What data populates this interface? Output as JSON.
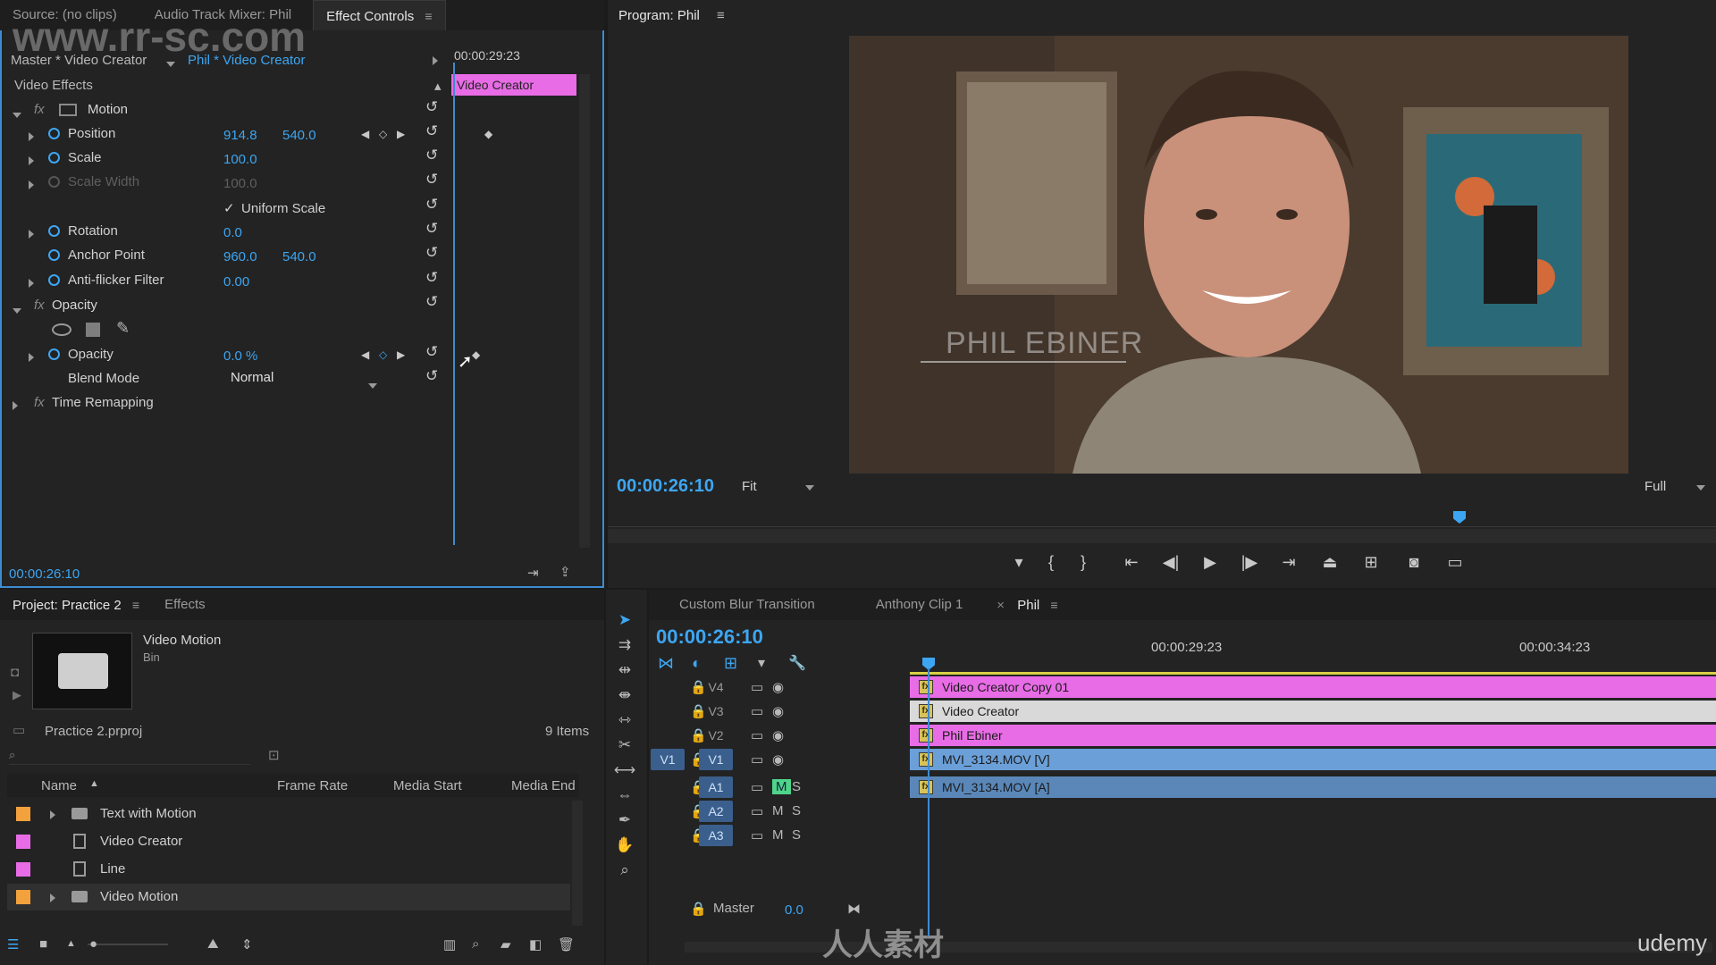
{
  "source_tabs": {
    "source": "Source: (no clips)",
    "mixer": "Audio Track Mixer: Phil",
    "effect_controls": "Effect Controls"
  },
  "effect_controls": {
    "master_label": "Master * Video Creator",
    "clip_label": "Phil * Video Creator",
    "timecode_head": "00:00:29:23",
    "clip_bar": "Video Creator",
    "section": "Video Effects",
    "motion": "Motion",
    "properties": [
      {
        "name": "Position",
        "v1": "914.8",
        "v2": "540.0"
      },
      {
        "name": "Scale",
        "v1": "100.0"
      },
      {
        "name": "Scale Width",
        "v1": "100.0"
      },
      {
        "name": "Rotation",
        "v1": "0.0"
      },
      {
        "name": "Anchor Point",
        "v1": "960.0",
        "v2": "540.0"
      },
      {
        "name": "Anti-flicker Filter",
        "v1": "0.00"
      }
    ],
    "uniform_scale": "Uniform Scale",
    "opacity_group": "Opacity",
    "opacity_prop": "Opacity",
    "opacity_value": "0.0 %",
    "blend_mode_label": "Blend Mode",
    "blend_mode_value": "Normal",
    "time_remapping": "Time Remapping",
    "footer_timecode": "00:00:26:10"
  },
  "program": {
    "title": "Program: Phil",
    "timecode": "00:00:26:10",
    "fit": "Fit",
    "quality": "Full",
    "lower_third": "PHIL EBINER"
  },
  "project": {
    "tab": "Project: Practice 2",
    "effects_tab": "Effects",
    "preview_name": "Video Motion",
    "preview_type": "Bin",
    "file": "Practice 2.prproj",
    "count": "9 Items",
    "columns": [
      "Name",
      "Frame Rate",
      "Media Start",
      "Media End"
    ],
    "items": [
      {
        "name": "Text with Motion",
        "color": "#f2a13c",
        "kind": "bin"
      },
      {
        "name": "Video Creator",
        "color": "#e86ce6",
        "kind": "seq"
      },
      {
        "name": "Line",
        "color": "#e86ce6",
        "kind": "seq"
      },
      {
        "name": "Video Motion",
        "color": "#f2a13c",
        "kind": "bin"
      }
    ]
  },
  "timeline": {
    "tabs": [
      "Custom Blur Transition",
      "Anthony Clip 1",
      "Phil"
    ],
    "timecode": "00:00:26:10",
    "ruler": [
      "00:00:29:23",
      "00:00:34:23"
    ],
    "tracks": [
      "V4",
      "V3",
      "V2",
      "V1",
      "A1",
      "A2",
      "A3"
    ],
    "source_patch": "V1",
    "master": "Master",
    "master_value": "0.0",
    "clips": [
      {
        "label": "Video Creator Copy 01",
        "color": "#e86ce6"
      },
      {
        "label": "Video Creator",
        "color": "#d9d9d9"
      },
      {
        "label": "Phil Ebiner",
        "color": "#e86ce6"
      },
      {
        "label": "MVI_3134.MOV [V]",
        "color": "#6b9fd8"
      },
      {
        "label": "MVI_3134.MOV [A]",
        "color": "#5a87b8"
      }
    ]
  },
  "watermark": "udemy",
  "watermark_site": "www.rr-sc.com",
  "watermark_cn": "人人素材"
}
